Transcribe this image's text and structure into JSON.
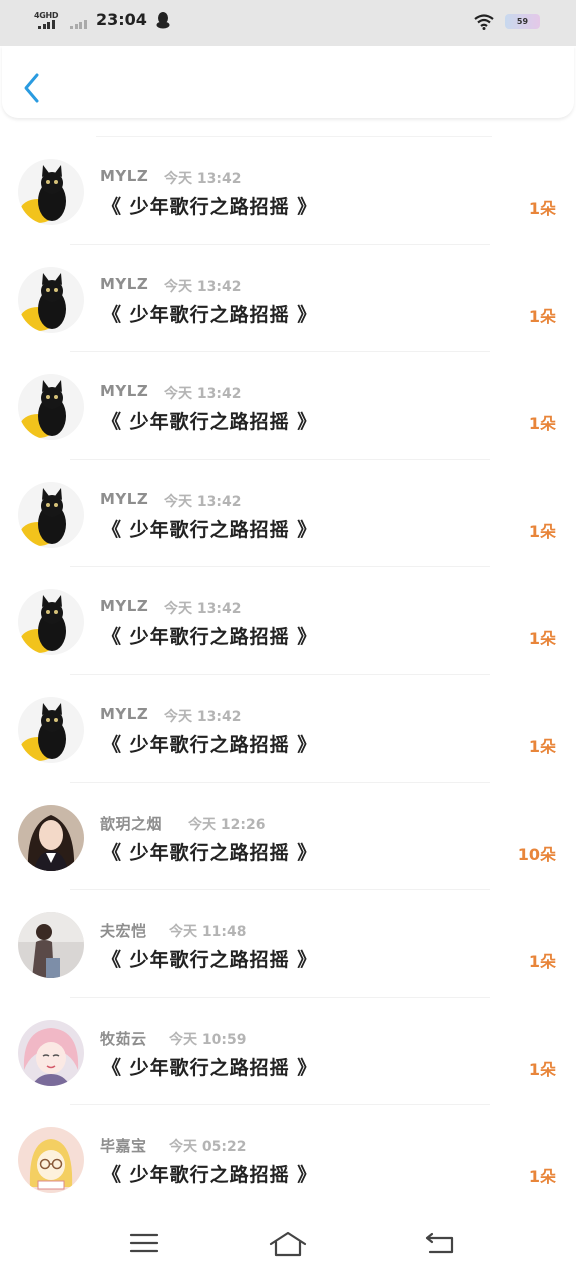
{
  "status_bar": {
    "network": "4GHD",
    "time": "23:04",
    "battery": "59"
  },
  "gifts": [
    {
      "name": "MYLZ",
      "time": "今天 13:42",
      "title": "《 少年歌行之路招摇 》",
      "count": "1朵",
      "avatar": "black-cat"
    },
    {
      "name": "MYLZ",
      "time": "今天 13:42",
      "title": "《 少年歌行之路招摇 》",
      "count": "1朵",
      "avatar": "black-cat"
    },
    {
      "name": "MYLZ",
      "time": "今天 13:42",
      "title": "《 少年歌行之路招摇 》",
      "count": "1朵",
      "avatar": "black-cat"
    },
    {
      "name": "MYLZ",
      "time": "今天 13:42",
      "title": "《 少年歌行之路招摇 》",
      "count": "1朵",
      "avatar": "black-cat"
    },
    {
      "name": "MYLZ",
      "time": "今天 13:42",
      "title": "《 少年歌行之路招摇 》",
      "count": "1朵",
      "avatar": "black-cat"
    },
    {
      "name": "MYLZ",
      "time": "今天 13:42",
      "title": "《 少年歌行之路招摇 》",
      "count": "1朵",
      "avatar": "black-cat"
    },
    {
      "name": "歆玥之烟",
      "time": "今天 12:26",
      "title": "《 少年歌行之路招摇 》",
      "count": "10朵",
      "avatar": "girl-photo"
    },
    {
      "name": "夫宏恺",
      "time": "今天 11:48",
      "title": "《 少年歌行之路招摇 》",
      "count": "1朵",
      "avatar": "person-photo"
    },
    {
      "name": "牧茹云",
      "time": "今天 10:59",
      "title": "《 少年歌行之路招摇 》",
      "count": "1朵",
      "avatar": "anime-girl"
    },
    {
      "name": "毕嘉宝",
      "time": "今天 05:22",
      "title": "《 少年歌行之路招摇 》",
      "count": "1朵",
      "avatar": "cartoon-girl"
    }
  ]
}
